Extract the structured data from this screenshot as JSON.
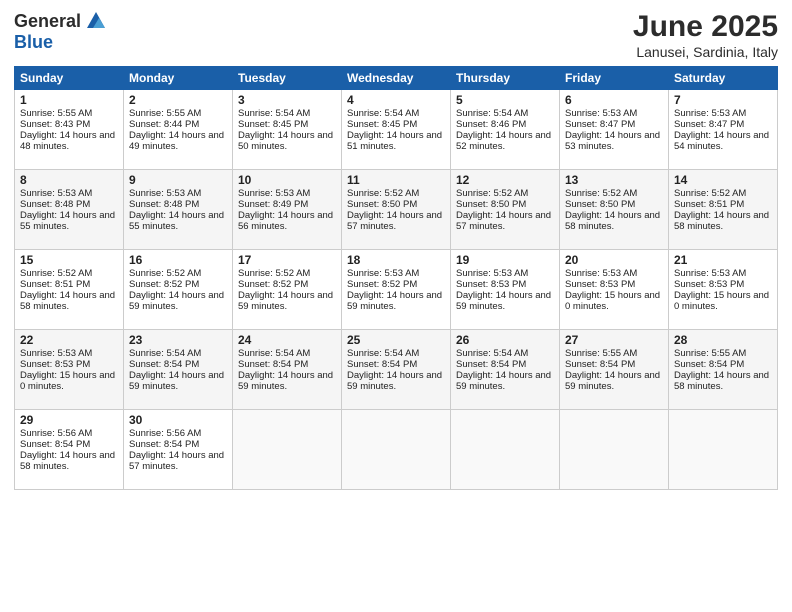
{
  "logo": {
    "general": "General",
    "blue": "Blue"
  },
  "calendar": {
    "title": "June 2025",
    "location": "Lanusei, Sardinia, Italy",
    "days": [
      "Sunday",
      "Monday",
      "Tuesday",
      "Wednesday",
      "Thursday",
      "Friday",
      "Saturday"
    ],
    "weeks": [
      [
        {
          "day": 1,
          "sunrise": "5:55 AM",
          "sunset": "8:43 PM",
          "daylight": "14 hours and 48 minutes."
        },
        {
          "day": 2,
          "sunrise": "5:55 AM",
          "sunset": "8:44 PM",
          "daylight": "14 hours and 49 minutes."
        },
        {
          "day": 3,
          "sunrise": "5:54 AM",
          "sunset": "8:45 PM",
          "daylight": "14 hours and 50 minutes."
        },
        {
          "day": 4,
          "sunrise": "5:54 AM",
          "sunset": "8:45 PM",
          "daylight": "14 hours and 51 minutes."
        },
        {
          "day": 5,
          "sunrise": "5:54 AM",
          "sunset": "8:46 PM",
          "daylight": "14 hours and 52 minutes."
        },
        {
          "day": 6,
          "sunrise": "5:53 AM",
          "sunset": "8:47 PM",
          "daylight": "14 hours and 53 minutes."
        },
        {
          "day": 7,
          "sunrise": "5:53 AM",
          "sunset": "8:47 PM",
          "daylight": "14 hours and 54 minutes."
        }
      ],
      [
        {
          "day": 8,
          "sunrise": "5:53 AM",
          "sunset": "8:48 PM",
          "daylight": "14 hours and 55 minutes."
        },
        {
          "day": 9,
          "sunrise": "5:53 AM",
          "sunset": "8:48 PM",
          "daylight": "14 hours and 55 minutes."
        },
        {
          "day": 10,
          "sunrise": "5:53 AM",
          "sunset": "8:49 PM",
          "daylight": "14 hours and 56 minutes."
        },
        {
          "day": 11,
          "sunrise": "5:52 AM",
          "sunset": "8:50 PM",
          "daylight": "14 hours and 57 minutes."
        },
        {
          "day": 12,
          "sunrise": "5:52 AM",
          "sunset": "8:50 PM",
          "daylight": "14 hours and 57 minutes."
        },
        {
          "day": 13,
          "sunrise": "5:52 AM",
          "sunset": "8:50 PM",
          "daylight": "14 hours and 58 minutes."
        },
        {
          "day": 14,
          "sunrise": "5:52 AM",
          "sunset": "8:51 PM",
          "daylight": "14 hours and 58 minutes."
        }
      ],
      [
        {
          "day": 15,
          "sunrise": "5:52 AM",
          "sunset": "8:51 PM",
          "daylight": "14 hours and 58 minutes."
        },
        {
          "day": 16,
          "sunrise": "5:52 AM",
          "sunset": "8:52 PM",
          "daylight": "14 hours and 59 minutes."
        },
        {
          "day": 17,
          "sunrise": "5:52 AM",
          "sunset": "8:52 PM",
          "daylight": "14 hours and 59 minutes."
        },
        {
          "day": 18,
          "sunrise": "5:53 AM",
          "sunset": "8:52 PM",
          "daylight": "14 hours and 59 minutes."
        },
        {
          "day": 19,
          "sunrise": "5:53 AM",
          "sunset": "8:53 PM",
          "daylight": "14 hours and 59 minutes."
        },
        {
          "day": 20,
          "sunrise": "5:53 AM",
          "sunset": "8:53 PM",
          "daylight": "15 hours and 0 minutes."
        },
        {
          "day": 21,
          "sunrise": "5:53 AM",
          "sunset": "8:53 PM",
          "daylight": "15 hours and 0 minutes."
        }
      ],
      [
        {
          "day": 22,
          "sunrise": "5:53 AM",
          "sunset": "8:53 PM",
          "daylight": "15 hours and 0 minutes."
        },
        {
          "day": 23,
          "sunrise": "5:54 AM",
          "sunset": "8:54 PM",
          "daylight": "14 hours and 59 minutes."
        },
        {
          "day": 24,
          "sunrise": "5:54 AM",
          "sunset": "8:54 PM",
          "daylight": "14 hours and 59 minutes."
        },
        {
          "day": 25,
          "sunrise": "5:54 AM",
          "sunset": "8:54 PM",
          "daylight": "14 hours and 59 minutes."
        },
        {
          "day": 26,
          "sunrise": "5:54 AM",
          "sunset": "8:54 PM",
          "daylight": "14 hours and 59 minutes."
        },
        {
          "day": 27,
          "sunrise": "5:55 AM",
          "sunset": "8:54 PM",
          "daylight": "14 hours and 59 minutes."
        },
        {
          "day": 28,
          "sunrise": "5:55 AM",
          "sunset": "8:54 PM",
          "daylight": "14 hours and 58 minutes."
        }
      ],
      [
        {
          "day": 29,
          "sunrise": "5:56 AM",
          "sunset": "8:54 PM",
          "daylight": "14 hours and 58 minutes."
        },
        {
          "day": 30,
          "sunrise": "5:56 AM",
          "sunset": "8:54 PM",
          "daylight": "14 hours and 57 minutes."
        },
        null,
        null,
        null,
        null,
        null
      ]
    ]
  }
}
